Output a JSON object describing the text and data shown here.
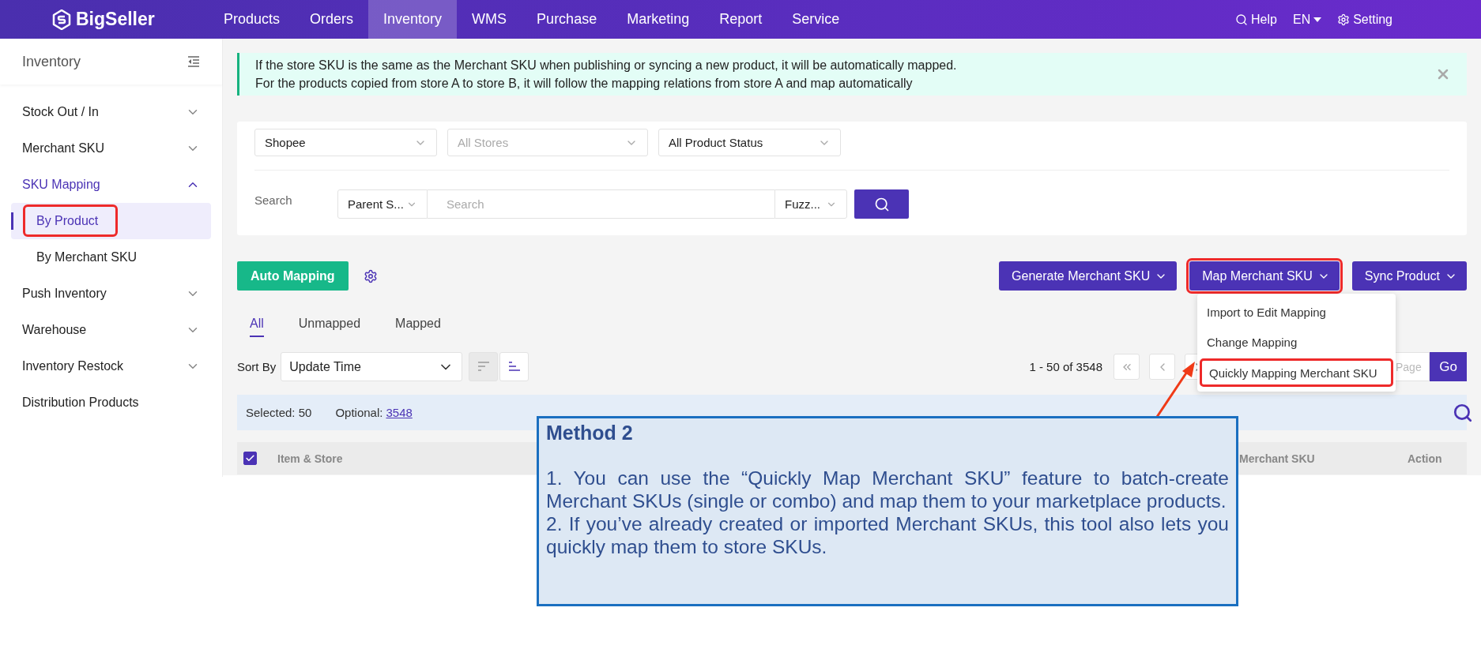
{
  "topbar": {
    "logo": "BigSeller",
    "nav": [
      {
        "label": "Products",
        "selected": false
      },
      {
        "label": "Orders",
        "selected": false
      },
      {
        "label": "Inventory",
        "selected": true
      },
      {
        "label": "WMS",
        "selected": false
      },
      {
        "label": "Purchase",
        "selected": false
      },
      {
        "label": "Marketing",
        "selected": false
      },
      {
        "label": "Report",
        "selected": false
      },
      {
        "label": "Service",
        "selected": false
      }
    ],
    "help": "Help",
    "language": "EN",
    "settings": "Setting"
  },
  "sidebar": {
    "title": "Inventory",
    "items": [
      {
        "label": "Stock Out / In",
        "kind": "group",
        "expanded": false,
        "selected": false
      },
      {
        "label": "Merchant SKU",
        "kind": "group",
        "expanded": false,
        "selected": false
      },
      {
        "label": "SKU Mapping",
        "kind": "group",
        "expanded": true,
        "selected": true,
        "children": [
          {
            "label": "By Product",
            "selected": true,
            "highlighted": true
          },
          {
            "label": "By Merchant SKU",
            "selected": false,
            "highlighted": false
          }
        ]
      },
      {
        "label": "Push Inventory",
        "kind": "group",
        "expanded": false,
        "selected": false
      },
      {
        "label": "Warehouse",
        "kind": "group",
        "expanded": false,
        "selected": false
      },
      {
        "label": "Inventory Restock",
        "kind": "group",
        "expanded": false,
        "selected": false
      },
      {
        "label": "Distribution Products",
        "kind": "link",
        "selected": false
      }
    ]
  },
  "notice": {
    "lines": [
      "If the store SKU is the same as the Merchant SKU when publishing or syncing a new product, it will be automatically mapped.",
      "For the products copied from store A to store B, it will follow the mapping relations from store A and map automatically"
    ]
  },
  "filters": {
    "selects": [
      {
        "value": "Shopee"
      },
      {
        "placeholder": "All Stores"
      },
      {
        "value": "All Product Status"
      }
    ],
    "search": {
      "label": "Search",
      "field": "Parent S...",
      "placeholder": "Search",
      "match": "Fuzz..."
    }
  },
  "actions": {
    "auto_mapping": "Auto Mapping",
    "buttons": [
      {
        "label": "Generate Merchant SKU",
        "highlighted": false
      },
      {
        "label": "Map Merchant SKU",
        "highlighted": true
      },
      {
        "label": "Sync Product",
        "highlighted": false
      }
    ]
  },
  "dropdown": {
    "items": [
      {
        "label": "Import to Edit Mapping",
        "highlighted": false
      },
      {
        "label": "Change Mapping",
        "highlighted": false
      },
      {
        "label": "Quickly Mapping Merchant SKU",
        "highlighted": true
      }
    ]
  },
  "tabs": [
    {
      "label": "All",
      "selected": true
    },
    {
      "label": "Unmapped",
      "selected": false
    },
    {
      "label": "Mapped",
      "selected": false
    }
  ],
  "sort": {
    "label": "Sort By",
    "value": "Update Time",
    "buttons": [
      {
        "selected": false
      },
      {
        "selected": true
      }
    ]
  },
  "pagination": {
    "summary": "1 - 50 of 3548",
    "page_placeholder": "Page",
    "go": "Go"
  },
  "selection": {
    "selected": "Selected: 50",
    "optional_label": "Optional:",
    "optional_count": "3548"
  },
  "table": {
    "select_all_checked": true,
    "columns": [
      "Item & Store",
      "Merchant SKU",
      "Action"
    ]
  },
  "callout": {
    "title": "Method 2",
    "paragraphs": [
      "1. You can use the “Quickly Map Merchant SKU” feature to batch-create Merchant SKUs (single or combo) and map them to your marketplace products.",
      "2. If you’ve already created or imported Merchant SKUs, this tool also lets you quickly map them to store SKUs."
    ]
  }
}
